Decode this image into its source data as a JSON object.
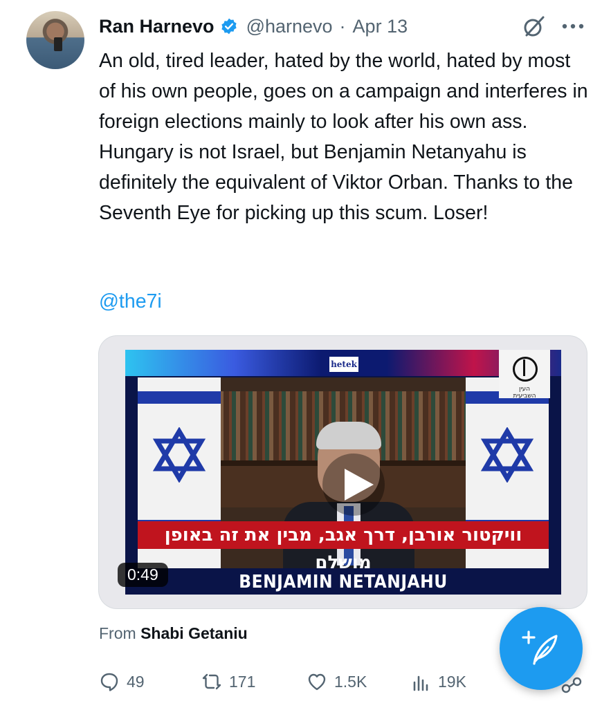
{
  "tweet": {
    "author_name": "Ran Harnevo",
    "handle": "@harnevo",
    "separator": "·",
    "date": "Apr 13",
    "text": "An old, tired leader, hated by the world, hated by most of his own people, goes on a campaign and interferes in foreign elections mainly to look after his own ass. Hungary is not Israel, but Benjamin Netanyahu is definitely the equivalent of Viktor Orban. Thanks to the Seventh Eye for picking up this scum. Loser!",
    "mention": "@the7i"
  },
  "media": {
    "channel_badge": "hetek",
    "logo_caption": "העין השביעית",
    "subtitle": "וויקטור אורבן, דרך אגב, מבין את זה באופן מושלם",
    "lower_third": "BENJAMIN NETANJAHU",
    "duration": "0:49"
  },
  "attribution": {
    "prefix": "From",
    "author": "Shabi Getaniu"
  },
  "actions": {
    "replies": "49",
    "retweets": "171",
    "likes": "1.5K",
    "views": "19K"
  },
  "icons": [
    "verified-badge-icon",
    "grok-icon",
    "more-icon",
    "play-icon",
    "reply-icon",
    "retweet-icon",
    "like-icon",
    "views-icon",
    "compose-icon",
    "share-icon"
  ],
  "colors": {
    "accent": "#1d9bf0",
    "text": "#0f1419",
    "muted": "#536471",
    "subtitle_bar": "#c0141e"
  }
}
